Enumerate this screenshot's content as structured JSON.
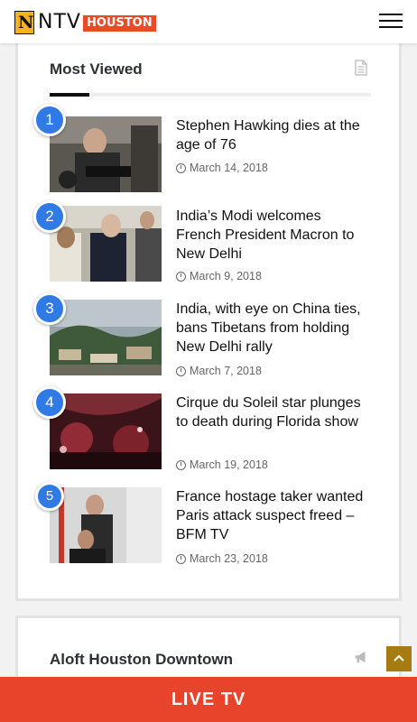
{
  "header": {
    "logo_letter": "N",
    "logo_word": "NTV",
    "logo_tag": "HOUSTON",
    "menu_icon": "hamburger-icon"
  },
  "most_viewed": {
    "title": "Most Viewed",
    "icon": "document-icon",
    "posts": [
      {
        "rank": "1",
        "title": "Stephen Hawking dies at the age of 76",
        "date": "March 14, 2018"
      },
      {
        "rank": "2",
        "title": "India’s Modi welcomes French President Macron to New Delhi",
        "date": "March 9, 2018"
      },
      {
        "rank": "3",
        "title": "India, with eye on China ties, bans Tibetans from holding New Delhi rally",
        "date": "March 7, 2018"
      },
      {
        "rank": "4",
        "title": "Cirque du Soleil star plunges to death during Florida show",
        "date": "March 19, 2018"
      },
      {
        "rank": "5",
        "title": "France hostage taker wanted Paris attack suspect freed – BFM TV",
        "date": "March 23, 2018"
      }
    ]
  },
  "second_widget": {
    "title": "Aloft Houston Downtown",
    "icon": "megaphone-icon"
  },
  "live_bar": {
    "label": "LIVE TV"
  },
  "scroll_top": {
    "icon": "chevron-up-icon"
  },
  "colors": {
    "accent_blue": "#2f7ae5",
    "live_red": "#e8442b",
    "logo_orange": "#e84b27",
    "logo_yellow": "#f3b320",
    "scroll_gold": "#a57b12"
  }
}
